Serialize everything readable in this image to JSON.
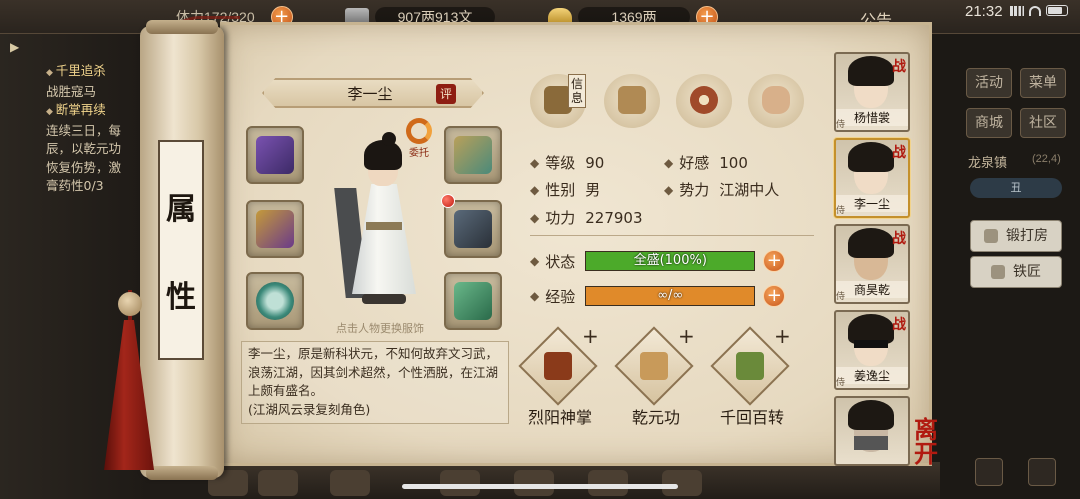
{
  "status_bar": {
    "stamina": "体力172/320",
    "coins": "907两913文",
    "ingots": "1369两",
    "notice": "公告",
    "clock": "21:32"
  },
  "quest": {
    "toggle": "▶",
    "lines": [
      {
        "text": "千里追杀",
        "title": true
      },
      {
        "text": "战胜寇马",
        "title": false
      },
      {
        "text": "断掌再续",
        "title": true
      },
      {
        "text": "连续三日，每",
        "title": false
      },
      {
        "text": "辰，以乾元功",
        "title": false
      },
      {
        "text": "恢复伤势，激",
        "title": false
      },
      {
        "text": "膏药性0/3",
        "title": false
      }
    ]
  },
  "right_menu": {
    "activity": "活动",
    "menu": "菜单",
    "shop": "商城",
    "community": "社区",
    "town": "龙泉镇",
    "coord": "(22,4)",
    "time": "丑",
    "forge_house": "锻打房",
    "blacksmith": "铁匠"
  },
  "scroll": {
    "title_chars": [
      "属",
      "性"
    ]
  },
  "character": {
    "name": "李一尘",
    "rate_label": "评",
    "entrust_label": "委托",
    "caption": "点击人物更换服饰",
    "description": "李一尘，原是新科状元，不知何故弃文习武，浪荡江湖，因其剑术超然，个性洒脱，在江湖上颇有盛名。",
    "credit": "(江湖风云录复刻角色)"
  },
  "tabs": {
    "info_label": "信息",
    "items": [
      {
        "icon": "info-tab-icon",
        "color": "#8a6a3a"
      },
      {
        "icon": "scroll-tab-icon",
        "color": "#b08a54"
      },
      {
        "icon": "bagua-tab-icon",
        "color": "#a04a2a"
      },
      {
        "icon": "meridian-tab-icon",
        "color": "#d8b08a"
      }
    ]
  },
  "stats": {
    "level_label": "等级",
    "level": "90",
    "favor_label": "好感",
    "favor": "100",
    "gender_label": "性别",
    "gender": "男",
    "faction_label": "势力",
    "faction": "江湖中人",
    "power_label": "功力",
    "power": "227903",
    "status_label": "状态",
    "status_value": "全盛(100%)",
    "status_fill": 1.0,
    "status_color": "#4caa2a",
    "exp_label": "经验",
    "exp_value": "∞/∞",
    "exp_fill": 1.0,
    "exp_color": "#e08a2a"
  },
  "skills": [
    {
      "name": "烈阳神掌",
      "color": "#8a3a1a"
    },
    {
      "name": "乾元功",
      "color": "#c89a5a"
    },
    {
      "name": "千回百转",
      "color": "#6a8a3a"
    }
  ],
  "roster": [
    {
      "name": "杨惜裳",
      "fight": "战",
      "tag": "侍"
    },
    {
      "name": "李一尘",
      "fight": "战",
      "tag": "侍"
    },
    {
      "name": "商昊乾",
      "fight": "战",
      "tag": "侍"
    },
    {
      "name": "姜逸尘",
      "fight": "战",
      "tag": "侍"
    },
    {
      "name": "",
      "fight": "",
      "tag": ""
    }
  ],
  "leave_label": "离开",
  "bottom_bar": [
    "",
    "",
    "",
    "",
    "",
    "",
    ""
  ]
}
